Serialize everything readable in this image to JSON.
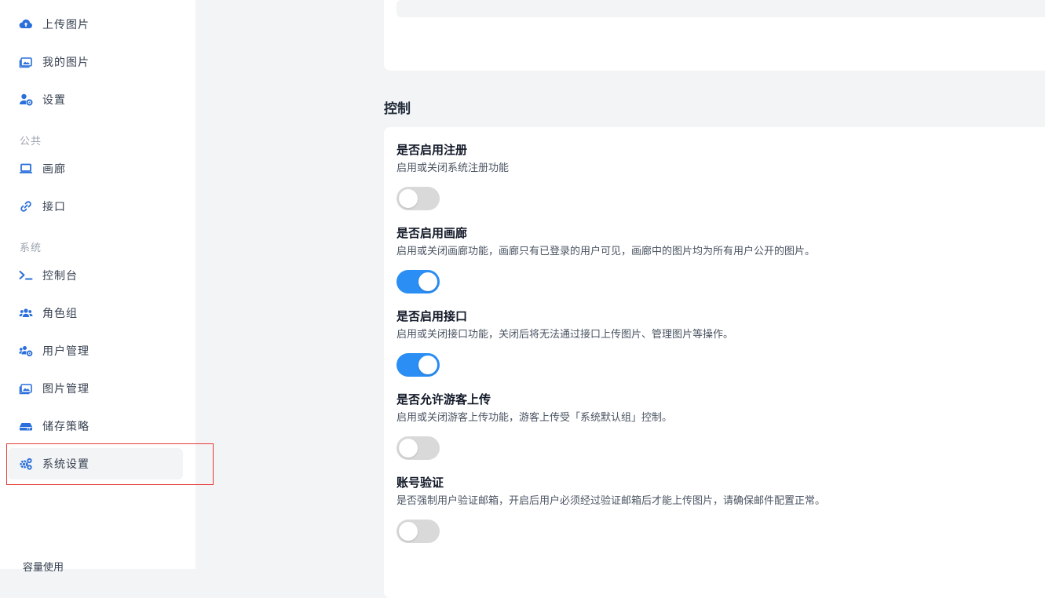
{
  "sidebar": {
    "items": [
      {
        "label": "上传图片",
        "icon": "cloud-upload-icon"
      },
      {
        "label": "我的图片",
        "icon": "images-icon"
      },
      {
        "label": "设置",
        "icon": "user-gear-icon"
      },
      {
        "label": "画廊",
        "icon": "laptop-icon"
      },
      {
        "label": "接口",
        "icon": "link-icon"
      },
      {
        "label": "控制台",
        "icon": "terminal-icon"
      },
      {
        "label": "角色组",
        "icon": "users-icon"
      },
      {
        "label": "用户管理",
        "icon": "users-gear-icon"
      },
      {
        "label": "图片管理",
        "icon": "images-icon"
      },
      {
        "label": "储存策略",
        "icon": "hard-drive-icon"
      },
      {
        "label": "系统设置",
        "icon": "gears-icon"
      }
    ],
    "sections": {
      "public": "公共",
      "system": "系统"
    },
    "capacity_label": "容量使用"
  },
  "main": {
    "section_title": "控制",
    "settings": [
      {
        "title": "是否启用注册",
        "desc": "启用或关闭系统注册功能",
        "enabled": false
      },
      {
        "title": "是否启用画廊",
        "desc": "启用或关闭画廊功能，画廊只有已登录的用户可见，画廊中的图片均为所有用户公开的图片。",
        "enabled": true
      },
      {
        "title": "是否启用接口",
        "desc": "启用或关闭接口功能，关闭后将无法通过接口上传图片、管理图片等操作。",
        "enabled": true
      },
      {
        "title": "是否允许游客上传",
        "desc": "启用或关闭游客上传功能，游客上传受「系统默认组」控制。",
        "enabled": false
      },
      {
        "title": "账号验证",
        "desc": "是否强制用户验证邮箱，开启后用户必须经过验证邮箱后才能上传图片，请确保邮件配置正常。",
        "enabled": false
      }
    ]
  },
  "colors": {
    "accent": "#2a8ef5",
    "toggle_off": "#d9d9d9",
    "highlight": "#e53935",
    "icon": "#2a6fdb"
  }
}
